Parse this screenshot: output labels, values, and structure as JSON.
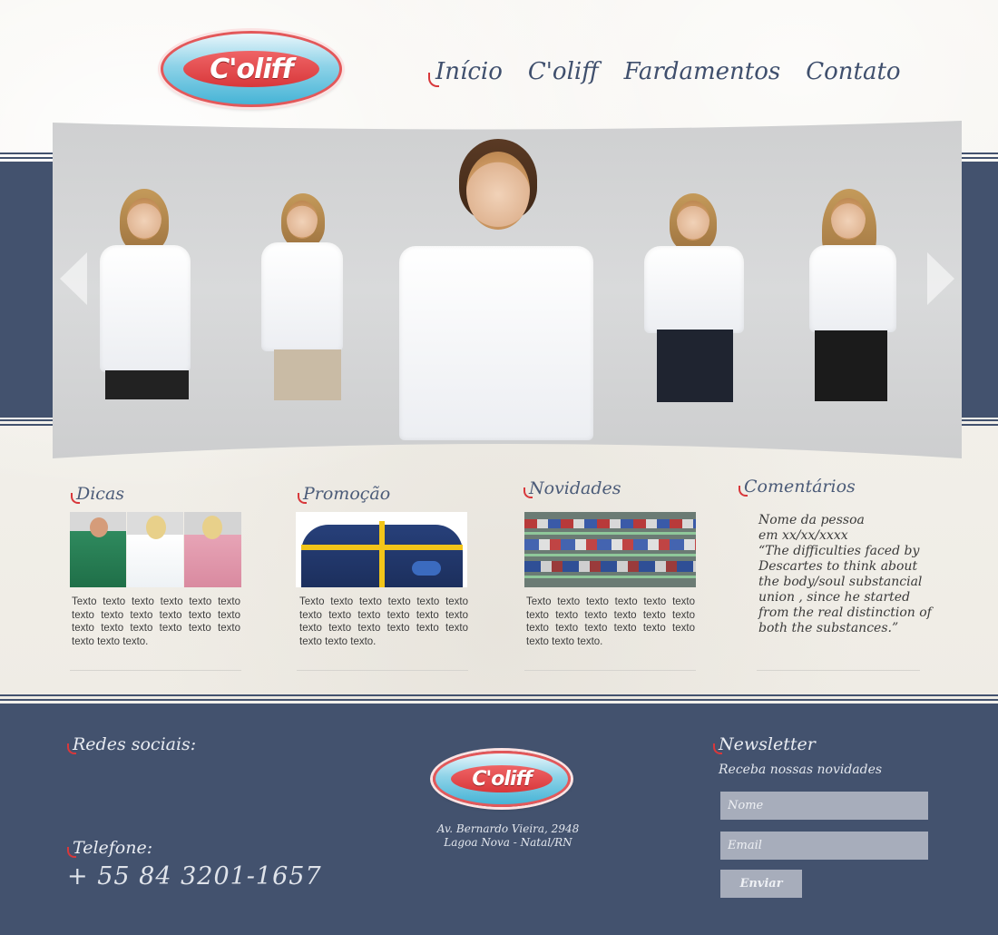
{
  "brand": {
    "logo_text": "C'oliff"
  },
  "nav": {
    "items": [
      "Início",
      "C'oliff",
      "Fardamentos",
      "Contato"
    ]
  },
  "sections": {
    "dicas": {
      "title": "Dicas",
      "text": "Texto texto texto texto texto texto texto texto texto texto texto texto texto texto texto texto texto texto texto texto texto."
    },
    "promocao": {
      "title": "Promoção",
      "text": "Texto texto texto texto texto texto texto texto texto texto texto texto texto texto texto texto texto texto texto texto texto."
    },
    "novidades": {
      "title": "Novidades",
      "text": "Texto texto texto texto texto texto texto texto texto texto texto texto texto texto texto texto texto texto texto texto texto."
    },
    "comentarios": {
      "title": "Comentários",
      "name": "Nome da pessoa",
      "date": "em xx/xx/xxxx",
      "quote": "“The difficulties faced by Descartes to think about the body/soul substancial union , since he started from the real distinction of both the substances.”"
    }
  },
  "footer": {
    "social_title": "Redes sociais:",
    "phone_title": "Telefone:",
    "phone": "+ 55 84 3201-1657",
    "address_line1": "Av. Bernardo Vieira, 2948",
    "address_line2": "Lagoa Nova - Natal/RN",
    "newsletter_title": "Newsletter",
    "newsletter_subtitle": "Receba nossas novidades",
    "name_placeholder": "Nome",
    "email_placeholder": "Email",
    "submit_label": "Enviar"
  },
  "colors": {
    "navy": "#43526e",
    "accent_red": "#d8383b",
    "logo_blue": "#46b4d6"
  }
}
